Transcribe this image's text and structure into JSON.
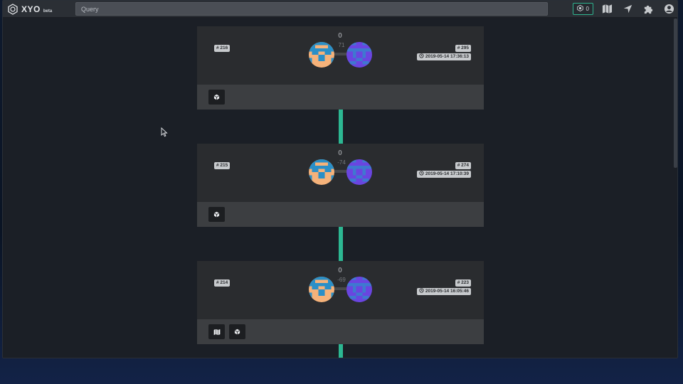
{
  "app": {
    "logo_text": "XYO",
    "logo_badge": "beta"
  },
  "search": {
    "placeholder": "Query",
    "value": ""
  },
  "nav": {
    "count": "0",
    "accent": "#2cb792",
    "icons": [
      "map-icon",
      "location-arrow-icon",
      "puzzle-icon",
      "user-circle-icon"
    ]
  },
  "blocks": [
    {
      "index": "# 216",
      "heading": "0",
      "rssi": "71",
      "other_index": "# 295",
      "time": "2019-05-14 17:36:13",
      "actions": [
        "cube-icon"
      ]
    },
    {
      "index": "# 215",
      "heading": "0",
      "rssi": "-74",
      "other_index": "# 274",
      "time": "2019-05-14 17:10:39",
      "actions": [
        "cube-icon"
      ]
    },
    {
      "index": "# 214",
      "heading": "0",
      "rssi": "-69",
      "other_index": "# 223",
      "time": "2019-05-14 16:05:46",
      "actions": [
        "map-icon",
        "cube-icon"
      ]
    }
  ]
}
